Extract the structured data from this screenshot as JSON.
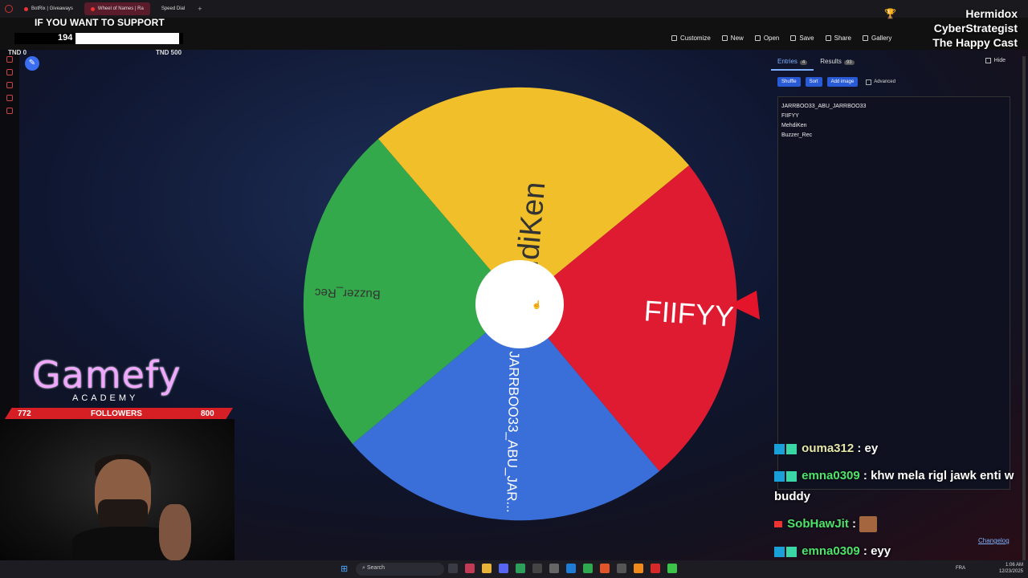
{
  "browser": {
    "tabs": [
      {
        "label": "BotRix | Giveaways",
        "active": false
      },
      {
        "label": "Wheel of Names | Ra",
        "active": true
      },
      {
        "label": "Speed Dial",
        "active": false
      }
    ],
    "new_tab": "+"
  },
  "overlay": {
    "support_text": "IF YOU WANT TO SUPPORT",
    "goal_current": "194",
    "goal_min": "TND 0",
    "goal_max": "TND 500",
    "goal_fraction": 0.388,
    "streamer_line1": "Hermidox",
    "streamer_line2": "CyberStrategist",
    "streamer_line3": "The Happy Cast",
    "brand_name": "Gamefy",
    "brand_sub": "ACADEMY",
    "followers_current": "772",
    "followers_label": "FOLLOWERS",
    "followers_goal": "800"
  },
  "toolbar": {
    "items": [
      {
        "label": "Customize",
        "icon": "palette-icon"
      },
      {
        "label": "New",
        "icon": "file-icon"
      },
      {
        "label": "Open",
        "icon": "folder-icon"
      },
      {
        "label": "Save",
        "icon": "save-icon"
      },
      {
        "label": "Share",
        "icon": "share-icon"
      },
      {
        "label": "Gallery",
        "icon": "search-icon"
      }
    ]
  },
  "wheel": {
    "segments": [
      {
        "label": "MehdiKen",
        "color": "#f0bf2a"
      },
      {
        "label": "FIIFYY",
        "color": "#df1b31"
      },
      {
        "label": "JARRBOO33_ABU_JAR...",
        "color": "#3a6fd9"
      },
      {
        "label": "Buzzer_Rec",
        "color": "#34a94b"
      }
    ],
    "hub_color": "#ffffff",
    "pointer_color": "#e4142a"
  },
  "panel": {
    "tab_entries": "Entries",
    "tab_entries_count": "4",
    "tab_results": "Results",
    "tab_results_count": "93",
    "hide_label": "Hide",
    "shuffle_label": "Shuffle",
    "sort_label": "Sort",
    "add_image_label": "Add image",
    "advanced_label": "Advanced",
    "entries": [
      "JARRBOO33_ABU_JARRBOO33",
      "FIIFYY",
      "MehdiKen",
      "Buzzer_Rec"
    ],
    "changelog": "Changelog"
  },
  "chat": [
    {
      "user": "ouma312",
      "message": " : ey"
    },
    {
      "user": "emna0309",
      "message": " : khw mela rigl jawk enti w buddy"
    },
    {
      "user": "SobHawJit",
      "message": " : "
    },
    {
      "user": "emna0309",
      "message": " : eyy"
    }
  ],
  "taskbar": {
    "search_label": "Search",
    "lang": "FRA",
    "time": "1:06 AM",
    "date": "12/23/2025"
  }
}
